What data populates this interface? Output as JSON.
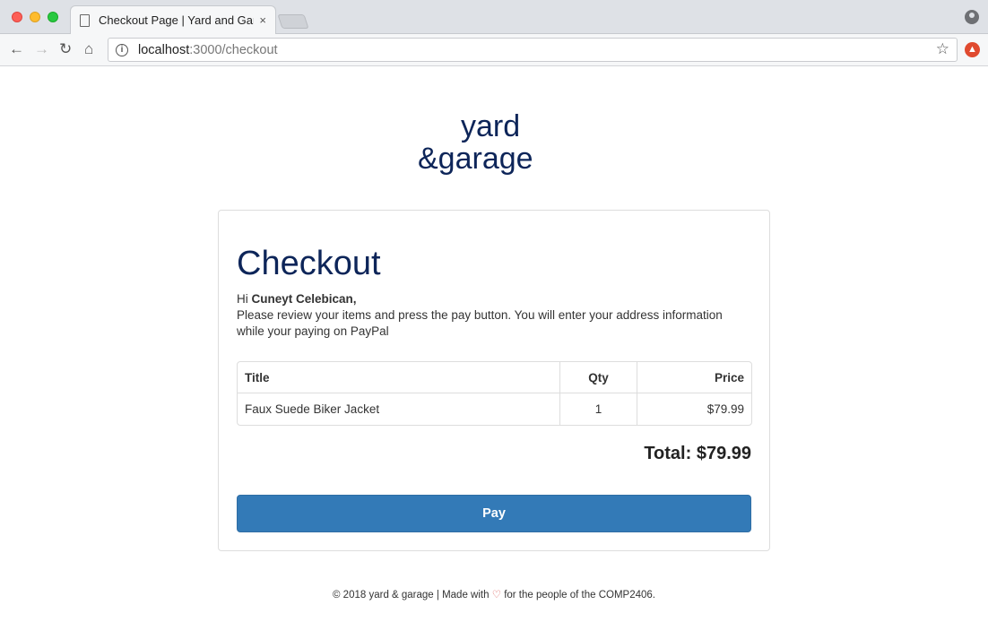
{
  "browser": {
    "tab_title": "Checkout Page | Yard and Garage",
    "tab_close": "×",
    "url_host": "localhost",
    "url_rest": ":3000/checkout",
    "icons": [
      "back-icon",
      "forward-icon",
      "reload-icon",
      "home-icon",
      "info-icon",
      "star-icon",
      "profile-icon",
      "extension-icon"
    ]
  },
  "logo": {
    "line1": "yard",
    "line2": "&garage",
    "color": "#0d2559"
  },
  "checkout": {
    "heading": "Checkout",
    "greeting_prefix": "Hi ",
    "customer_name": "Cuneyt Celebican,",
    "instructions": "Please review your items and press the pay button. You will enter your address information while your paying on PayPal",
    "table": {
      "headers": [
        "Title",
        "Qty",
        "Price"
      ],
      "rows": [
        {
          "title": "Faux Suede Biker Jacket",
          "qty": "1",
          "price": "$79.99"
        }
      ]
    },
    "total": "Total: $79.99",
    "pay_label": "Pay",
    "accent": "#337ab7"
  },
  "footer": {
    "before_heart": "© 2018 yard & garage | Made with ",
    "heart": "♡",
    "after_heart": " for the people of the COMP2406."
  }
}
